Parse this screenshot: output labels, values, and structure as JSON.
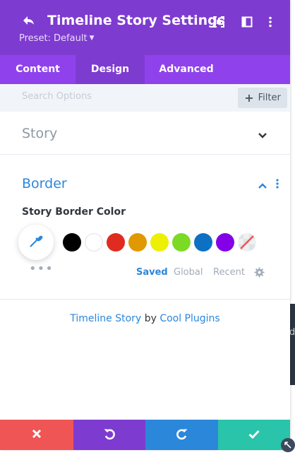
{
  "header": {
    "title": "Timeline Story Settings",
    "preset_label": "Preset: Default",
    "background_color": "#7e3bd0",
    "icons": [
      "undo-arrow-icon",
      "expand-icon",
      "sidebar-layout-icon",
      "kebab-menu-icon"
    ]
  },
  "tabs": [
    {
      "label": "Content",
      "active": false
    },
    {
      "label": "Design",
      "active": true
    },
    {
      "label": "Advanced",
      "active": false
    }
  ],
  "search": {
    "placeholder": "Search Options",
    "filter_label": "Filter"
  },
  "sections": {
    "story": {
      "title": "Story",
      "expanded": false
    },
    "border": {
      "title": "Border",
      "expanded": true,
      "field_label": "Story Border Color"
    }
  },
  "color_palette": {
    "swatches": [
      "#000000",
      "#ffffff",
      "#e02b20",
      "#e09900",
      "#edf000",
      "#7cda24",
      "#0c71c3",
      "#8300e9",
      "none"
    ],
    "tabs": [
      {
        "label": "Saved",
        "active": true
      },
      {
        "label": "Global",
        "active": false
      },
      {
        "label": "Recent",
        "active": false
      }
    ],
    "more_label": "•••"
  },
  "credit": {
    "plugin": "Timeline Story",
    "by": "by",
    "author": "Cool Plugins"
  },
  "footer": {
    "buttons": [
      {
        "action": "discard",
        "icon": "close-icon",
        "color": "#ef5555"
      },
      {
        "action": "undo",
        "icon": "undo-icon",
        "color": "#7e3bd0"
      },
      {
        "action": "redo",
        "icon": "redo-icon",
        "color": "#2b87da"
      },
      {
        "action": "save",
        "icon": "check-icon",
        "color": "#29c4a9"
      }
    ]
  },
  "colors": {
    "accent": "#2b87da",
    "tab_bar": "#8f42ec"
  }
}
